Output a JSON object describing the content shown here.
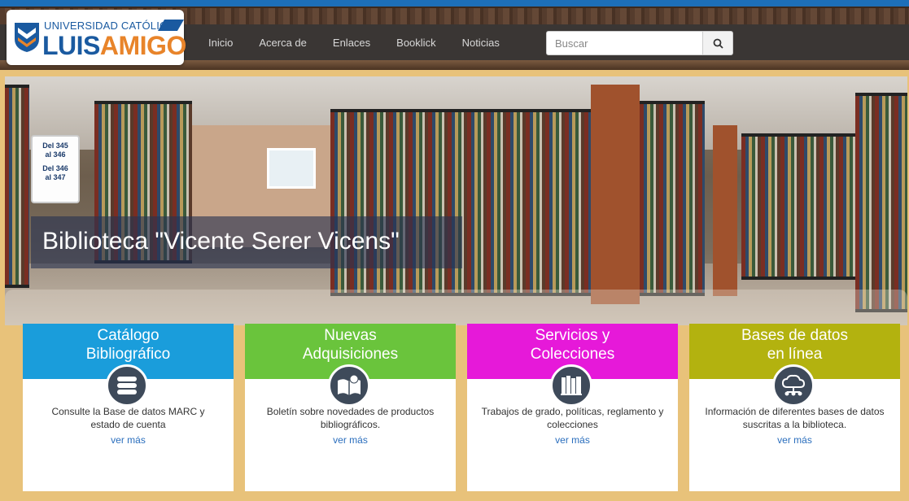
{
  "logo": {
    "top": "UNIVERSIDAD CATÓLICA",
    "name_a": "LUIS",
    "name_b": "AMIGO"
  },
  "nav": {
    "items": [
      "Inicio",
      "Acerca de",
      "Enlaces",
      "Booklick",
      "Noticias"
    ]
  },
  "search": {
    "placeholder": "Buscar",
    "icon": "search-icon"
  },
  "hero": {
    "title": "Biblioteca \"Vicente Serer Vicens\"",
    "sign": [
      "Del 345",
      "al 346",
      "Del 346",
      "al 347"
    ]
  },
  "cards": [
    {
      "title_1": "Catálogo",
      "title_2": "Bibliográfico",
      "color": "#1a9ddb",
      "icon": "books-stack-icon",
      "desc_1": "Consulte la Base de datos MARC y",
      "desc_2": "estado de cuenta",
      "link": "ver más"
    },
    {
      "title_1": "Nuevas",
      "title_2": "Adquisiciones",
      "color": "#6ac43c",
      "icon": "open-book-new-icon",
      "desc_1": "Boletín sobre novedades de productos",
      "desc_2": "bibliográficos.",
      "link": "ver más"
    },
    {
      "title_1": "Servicios y",
      "title_2": "Colecciones",
      "color": "#e619d9",
      "icon": "books-shelf-icon",
      "desc_1": "Trabajos de grado, políticas, reglamento y",
      "desc_2": "colecciones",
      "link": "ver más"
    },
    {
      "title_1": "Bases de datos",
      "title_2": "en línea",
      "color": "#b3b20f",
      "icon": "cloud-network-icon",
      "desc_1": "Información de diferentes bases de datos",
      "desc_2": "suscritas a la biblioteca.",
      "link": "ver más"
    }
  ]
}
